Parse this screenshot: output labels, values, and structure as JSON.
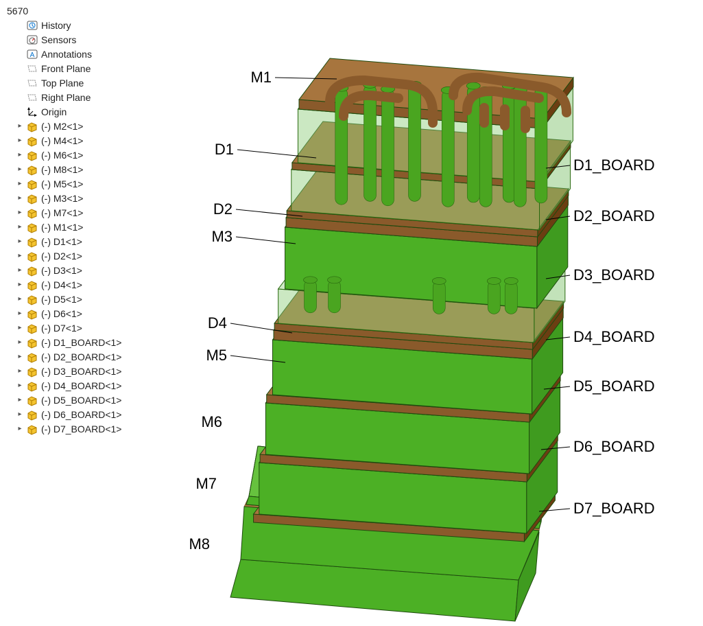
{
  "tree": {
    "root_label": "5670",
    "system_items": [
      {
        "label": "History",
        "icon": "history"
      },
      {
        "label": "Sensors",
        "icon": "sensors"
      },
      {
        "label": "Annotations",
        "icon": "annotations"
      },
      {
        "label": "Front Plane",
        "icon": "plane"
      },
      {
        "label": "Top Plane",
        "icon": "plane"
      },
      {
        "label": "Right Plane",
        "icon": "plane"
      },
      {
        "label": "Origin",
        "icon": "origin"
      }
    ],
    "parts": [
      "(-) M2<1>",
      "(-) M4<1>",
      "(-) M6<1>",
      "(-) M8<1>",
      "(-) M5<1>",
      "(-) M3<1>",
      "(-) M7<1>",
      "(-) M1<1>",
      "(-) D1<1>",
      "(-) D2<1>",
      "(-) D3<1>",
      "(-) D4<1>",
      "(-) D5<1>",
      "(-) D6<1>",
      "(-) D7<1>",
      "(-) D1_BOARD<1>",
      "(-) D2_BOARD<1>",
      "(-) D3_BOARD<1>",
      "(-) D4_BOARD<1>",
      "(-) D5_BOARD<1>",
      "(-) D6_BOARD<1>",
      "(-) D7_BOARD<1>"
    ]
  },
  "callouts": {
    "left": [
      {
        "key": "M1",
        "label": "M1"
      },
      {
        "key": "D1",
        "label": "D1"
      },
      {
        "key": "D2",
        "label": "D2"
      },
      {
        "key": "M3",
        "label": "M3"
      },
      {
        "key": "D4",
        "label": "D4"
      },
      {
        "key": "M5",
        "label": "M5"
      },
      {
        "key": "M6",
        "label": "M6"
      },
      {
        "key": "M7",
        "label": "M7"
      },
      {
        "key": "M8",
        "label": "M8"
      }
    ],
    "right": [
      {
        "key": "D1_BOARD",
        "label": "D1_BOARD"
      },
      {
        "key": "D2_BOARD",
        "label": "D2_BOARD"
      },
      {
        "key": "D3_BOARD",
        "label": "D3_BOARD"
      },
      {
        "key": "D4_BOARD",
        "label": "D4_BOARD"
      },
      {
        "key": "D5_BOARD",
        "label": "D5_BOARD"
      },
      {
        "key": "D6_BOARD",
        "label": "D6_BOARD"
      },
      {
        "key": "D7_BOARD",
        "label": "D7_BOARD"
      }
    ]
  },
  "colors": {
    "solid_side": "#3f9b1f",
    "solid_front": "#4cb025",
    "solid_top": "#66c23e",
    "trans_side": "rgba(120,190,100,0.45)",
    "trans_front": "rgba(140,205,120,0.45)",
    "trans_top": "rgba(160,215,140,0.50)",
    "copper": "#8a5a2b",
    "copper_top": "#a7753e",
    "via": "#4aa520",
    "edge": "#1e4a0e"
  }
}
